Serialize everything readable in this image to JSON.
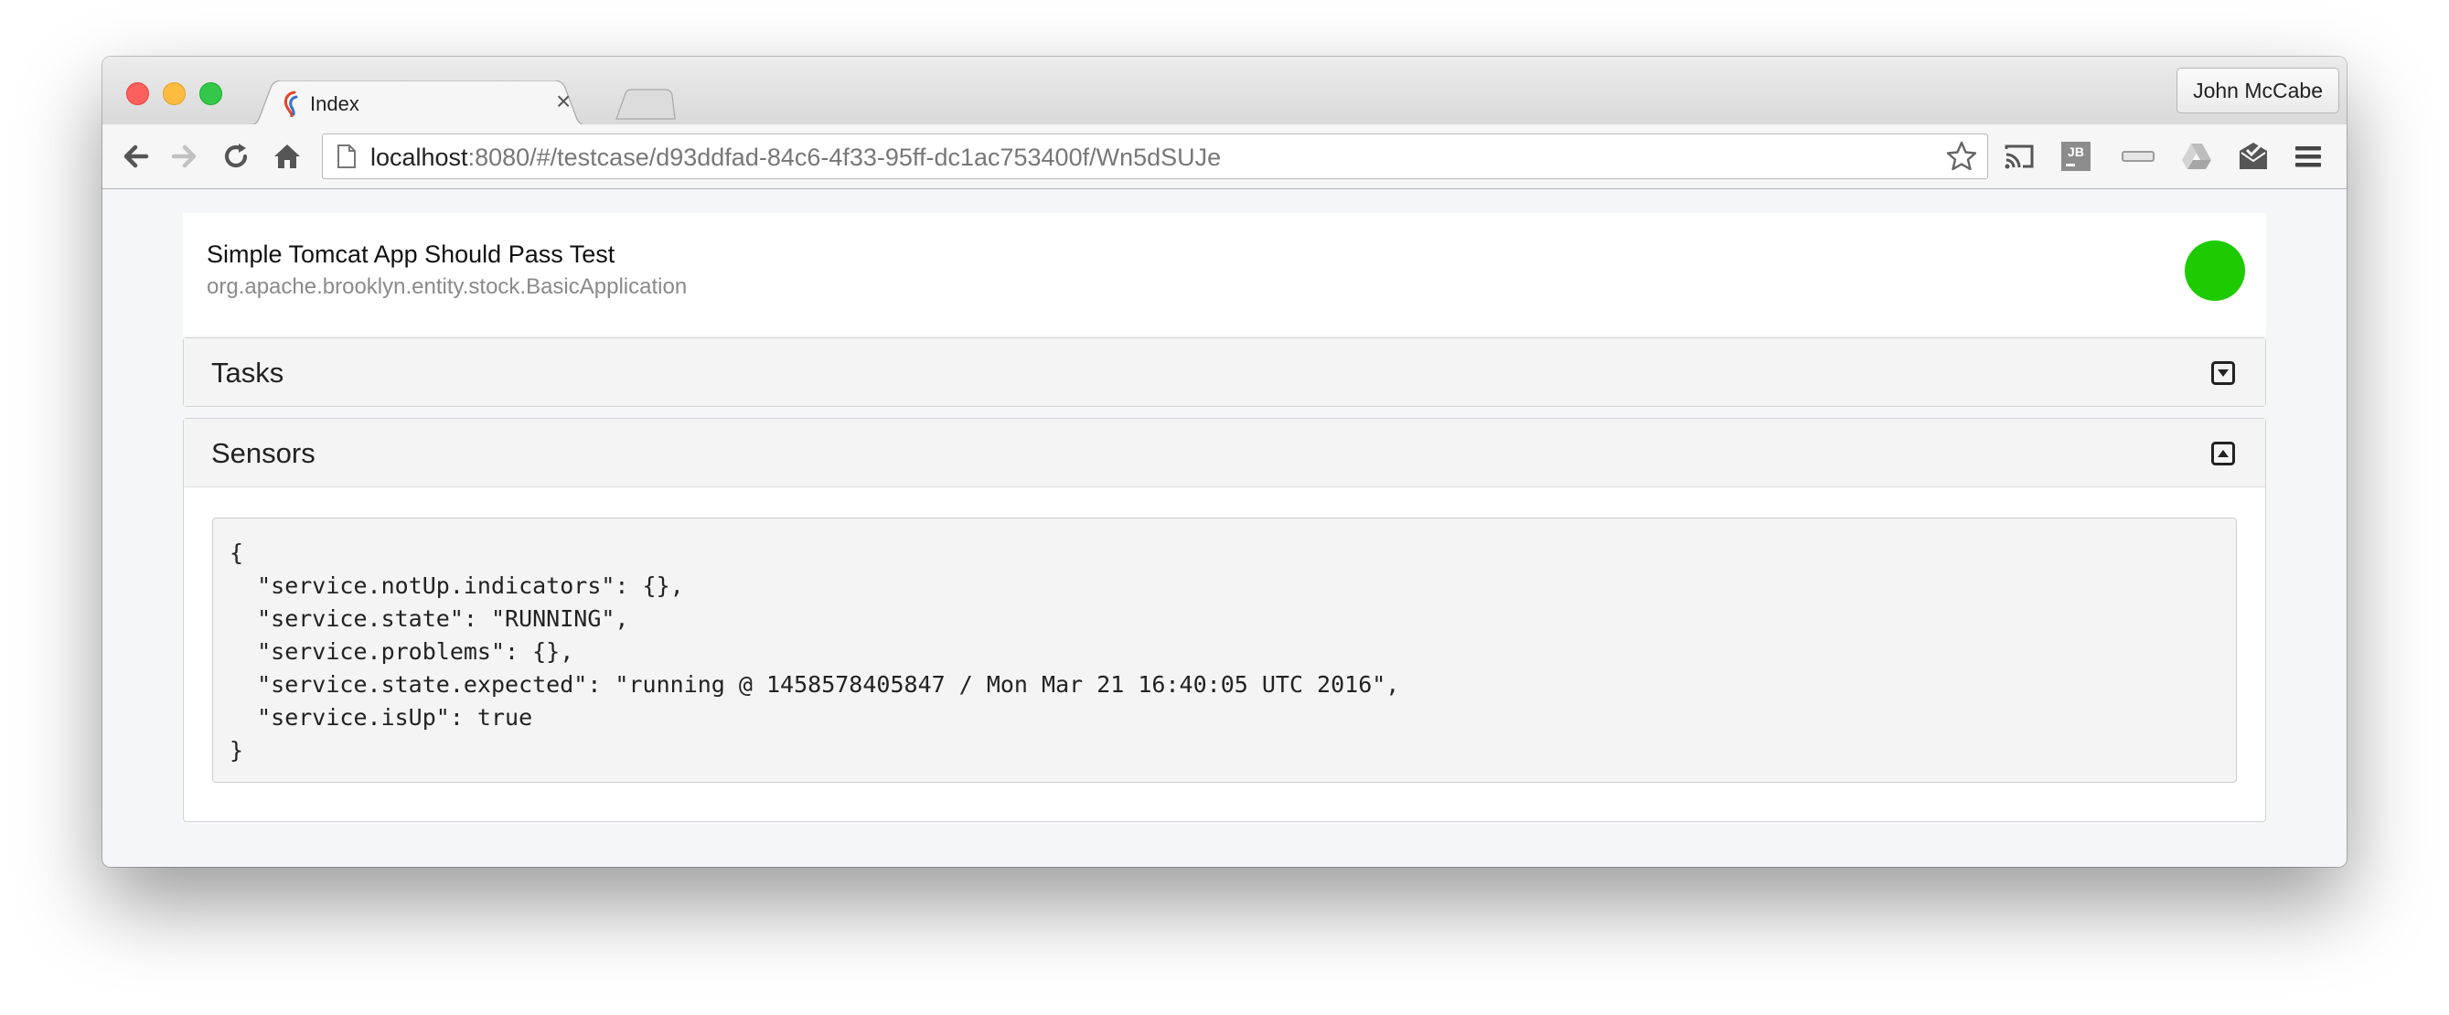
{
  "browser": {
    "tab": {
      "title": "Index",
      "close_glyph": "×",
      "favicon": "brooklyn-favicon-icon"
    },
    "profile_name": "John McCabe",
    "address": {
      "host": "localhost",
      "rest": ":8080/#/testcase/d93ddfad-84c6-4f33-95ff-dc1ac753400f/Wn5dSUJe"
    },
    "toolbar_icons": [
      "back-icon",
      "forward-icon",
      "reload-icon",
      "home-icon",
      "bookmark-star-icon",
      "cast-icon",
      "jb-extension-icon",
      "extension-bar-icon",
      "drive-icon",
      "mail-check-icon",
      "menu-icon"
    ]
  },
  "app": {
    "title": "Simple Tomcat App Should Pass Test",
    "type": "org.apache.brooklyn.entity.stock.BasicApplication",
    "status_color": "#1ecb00"
  },
  "panels": {
    "tasks": {
      "title": "Tasks",
      "state": "collapsed"
    },
    "sensors": {
      "title": "Sensors",
      "state": "expanded"
    }
  },
  "sensors_json_lines": [
    "{",
    "  \"service.notUp.indicators\": {},",
    "  \"service.state\": \"RUNNING\",",
    "  \"service.problems\": {},",
    "  \"service.state.expected\": \"running @ 1458578405847 / Mon Mar 21 16:40:05 UTC 2016\",",
    "  \"service.isUp\": true",
    "}"
  ]
}
